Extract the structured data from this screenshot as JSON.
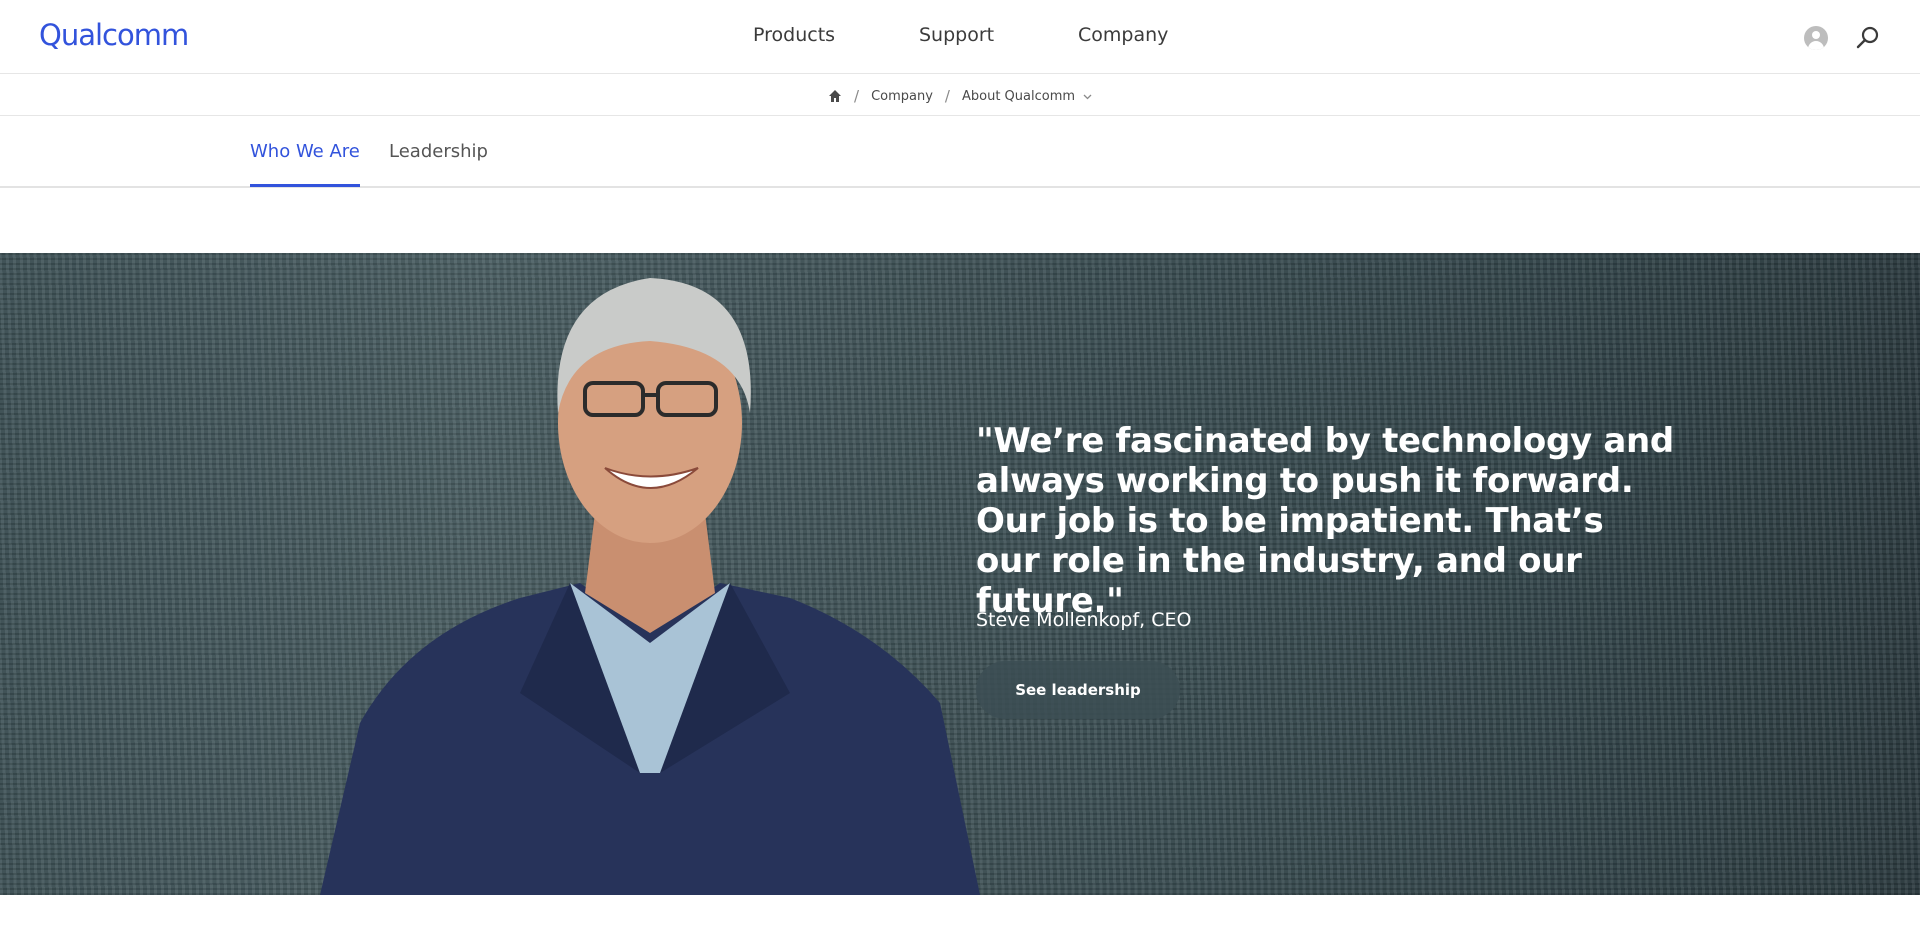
{
  "header": {
    "logo": "Qualcomm",
    "nav": [
      {
        "label": "Products"
      },
      {
        "label": "Support"
      },
      {
        "label": "Company"
      }
    ],
    "icons": [
      "user-icon",
      "search-icon"
    ]
  },
  "breadcrumb": {
    "home_icon": "home-icon",
    "items": [
      "Company",
      "About Qualcomm"
    ],
    "dropdown_icon": "chevron-down-icon"
  },
  "tabs": [
    {
      "label": "Who We Are",
      "active": true
    },
    {
      "label": "Leadership",
      "active": false
    }
  ],
  "hero": {
    "quote": "\"We’re fascinated by technology and always working to push it forward. Our job is to be impatient. That’s our role in the industry, and our future.\"",
    "attribution": "Steve Mollenkopf, CEO",
    "cta_label": "See leadership"
  },
  "colors": {
    "brand": "#3253dc",
    "hero_bg": "#3e5257",
    "text": "#3b3b3b"
  }
}
